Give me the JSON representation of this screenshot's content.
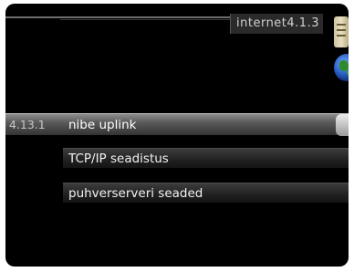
{
  "header": {
    "title": "internet4.1.3"
  },
  "icons": {
    "menu": "menu-icon",
    "globe": "globe-icon"
  },
  "menu": {
    "items": [
      {
        "number": "4.13.1",
        "label": "nibe uplink",
        "selected": true
      },
      {
        "label": "TCP/IP seadistus",
        "selected": false
      },
      {
        "label": "puhverserveri seaded",
        "selected": false
      }
    ]
  },
  "colors": {
    "background": "#000000",
    "text": "#f2f2f2",
    "selected_row": "#6a6a6a"
  }
}
